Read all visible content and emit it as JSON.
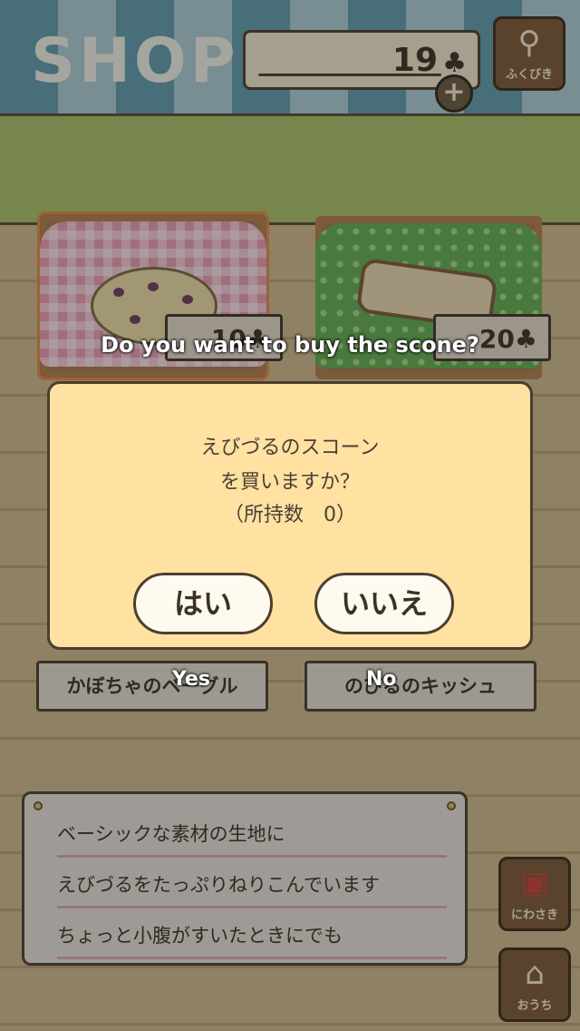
{
  "header": {
    "title": "SHOP",
    "coins": "19",
    "coin_icon": "clover-icon",
    "plus_label": "+",
    "lottery_label": "ふくびき"
  },
  "items": [
    {
      "name": "かぼちゃのベーグル",
      "price": "10"
    },
    {
      "name": "のびるのキッシュ",
      "price": "20"
    }
  ],
  "description": {
    "lines": [
      "ベーシックな素材の生地に",
      "えびづるをたっぷりねりこんでいます",
      "ちょっと小腹がすいたときにでも"
    ]
  },
  "side_buttons": {
    "garden_label": "にわさき",
    "home_label": "おうち"
  },
  "dialog": {
    "line1": "えびづるのスコーン",
    "line2": "を買いますか？",
    "line3": "（所持数　0）",
    "yes_label": "はい",
    "no_label": "いいえ"
  },
  "overlay": {
    "question": "Do you want to buy the scone?",
    "yes": "Yes",
    "no": "No"
  },
  "colors": {
    "dialog_bg": "#ffe1a1",
    "header_stripe_dark": "#5f9bb0",
    "header_stripe_light": "#a9cdd8",
    "grass": "#a6c06a"
  }
}
